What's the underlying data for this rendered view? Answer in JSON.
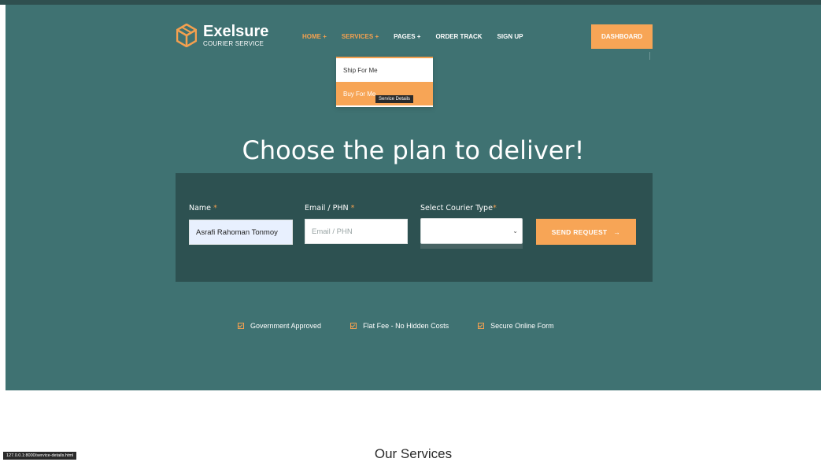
{
  "brand": {
    "name": "Exelsure",
    "tagline": "COURIER SERVICE",
    "accent": "#f7a556",
    "hero_bg": "#3f7272",
    "panel_bg": "#2d5151"
  },
  "nav": {
    "items": [
      "HOME +",
      "SERVICES +",
      "PAGES +",
      "ORDER TRACK",
      "SIGN UP"
    ],
    "dashboard_label": "DASHBOARD"
  },
  "dropdown": {
    "items": [
      "Ship For Me",
      "Buy For Me"
    ],
    "tooltip": "Service Details"
  },
  "hero": {
    "title": "Choose the plan to deliver!"
  },
  "form": {
    "name_label": "Name",
    "name_value": "Asrafi  Rahoman Tonmoy",
    "email_label": "Email / PHN",
    "email_placeholder": "Email / PHN",
    "courier_label": "Select Courier Type",
    "courier_selected": "",
    "required_mark": "*",
    "send_label": "SEND REQUEST",
    "send_arrow": "→",
    "select_arrow": "⌄"
  },
  "features": [
    "Government Approved",
    "Flat Fee - No Hidden Costs",
    "Secure Online Form"
  ],
  "section": {
    "title": "Our Services"
  },
  "status_bar": {
    "url": "127.0.0.1:8000/service-details.html"
  }
}
